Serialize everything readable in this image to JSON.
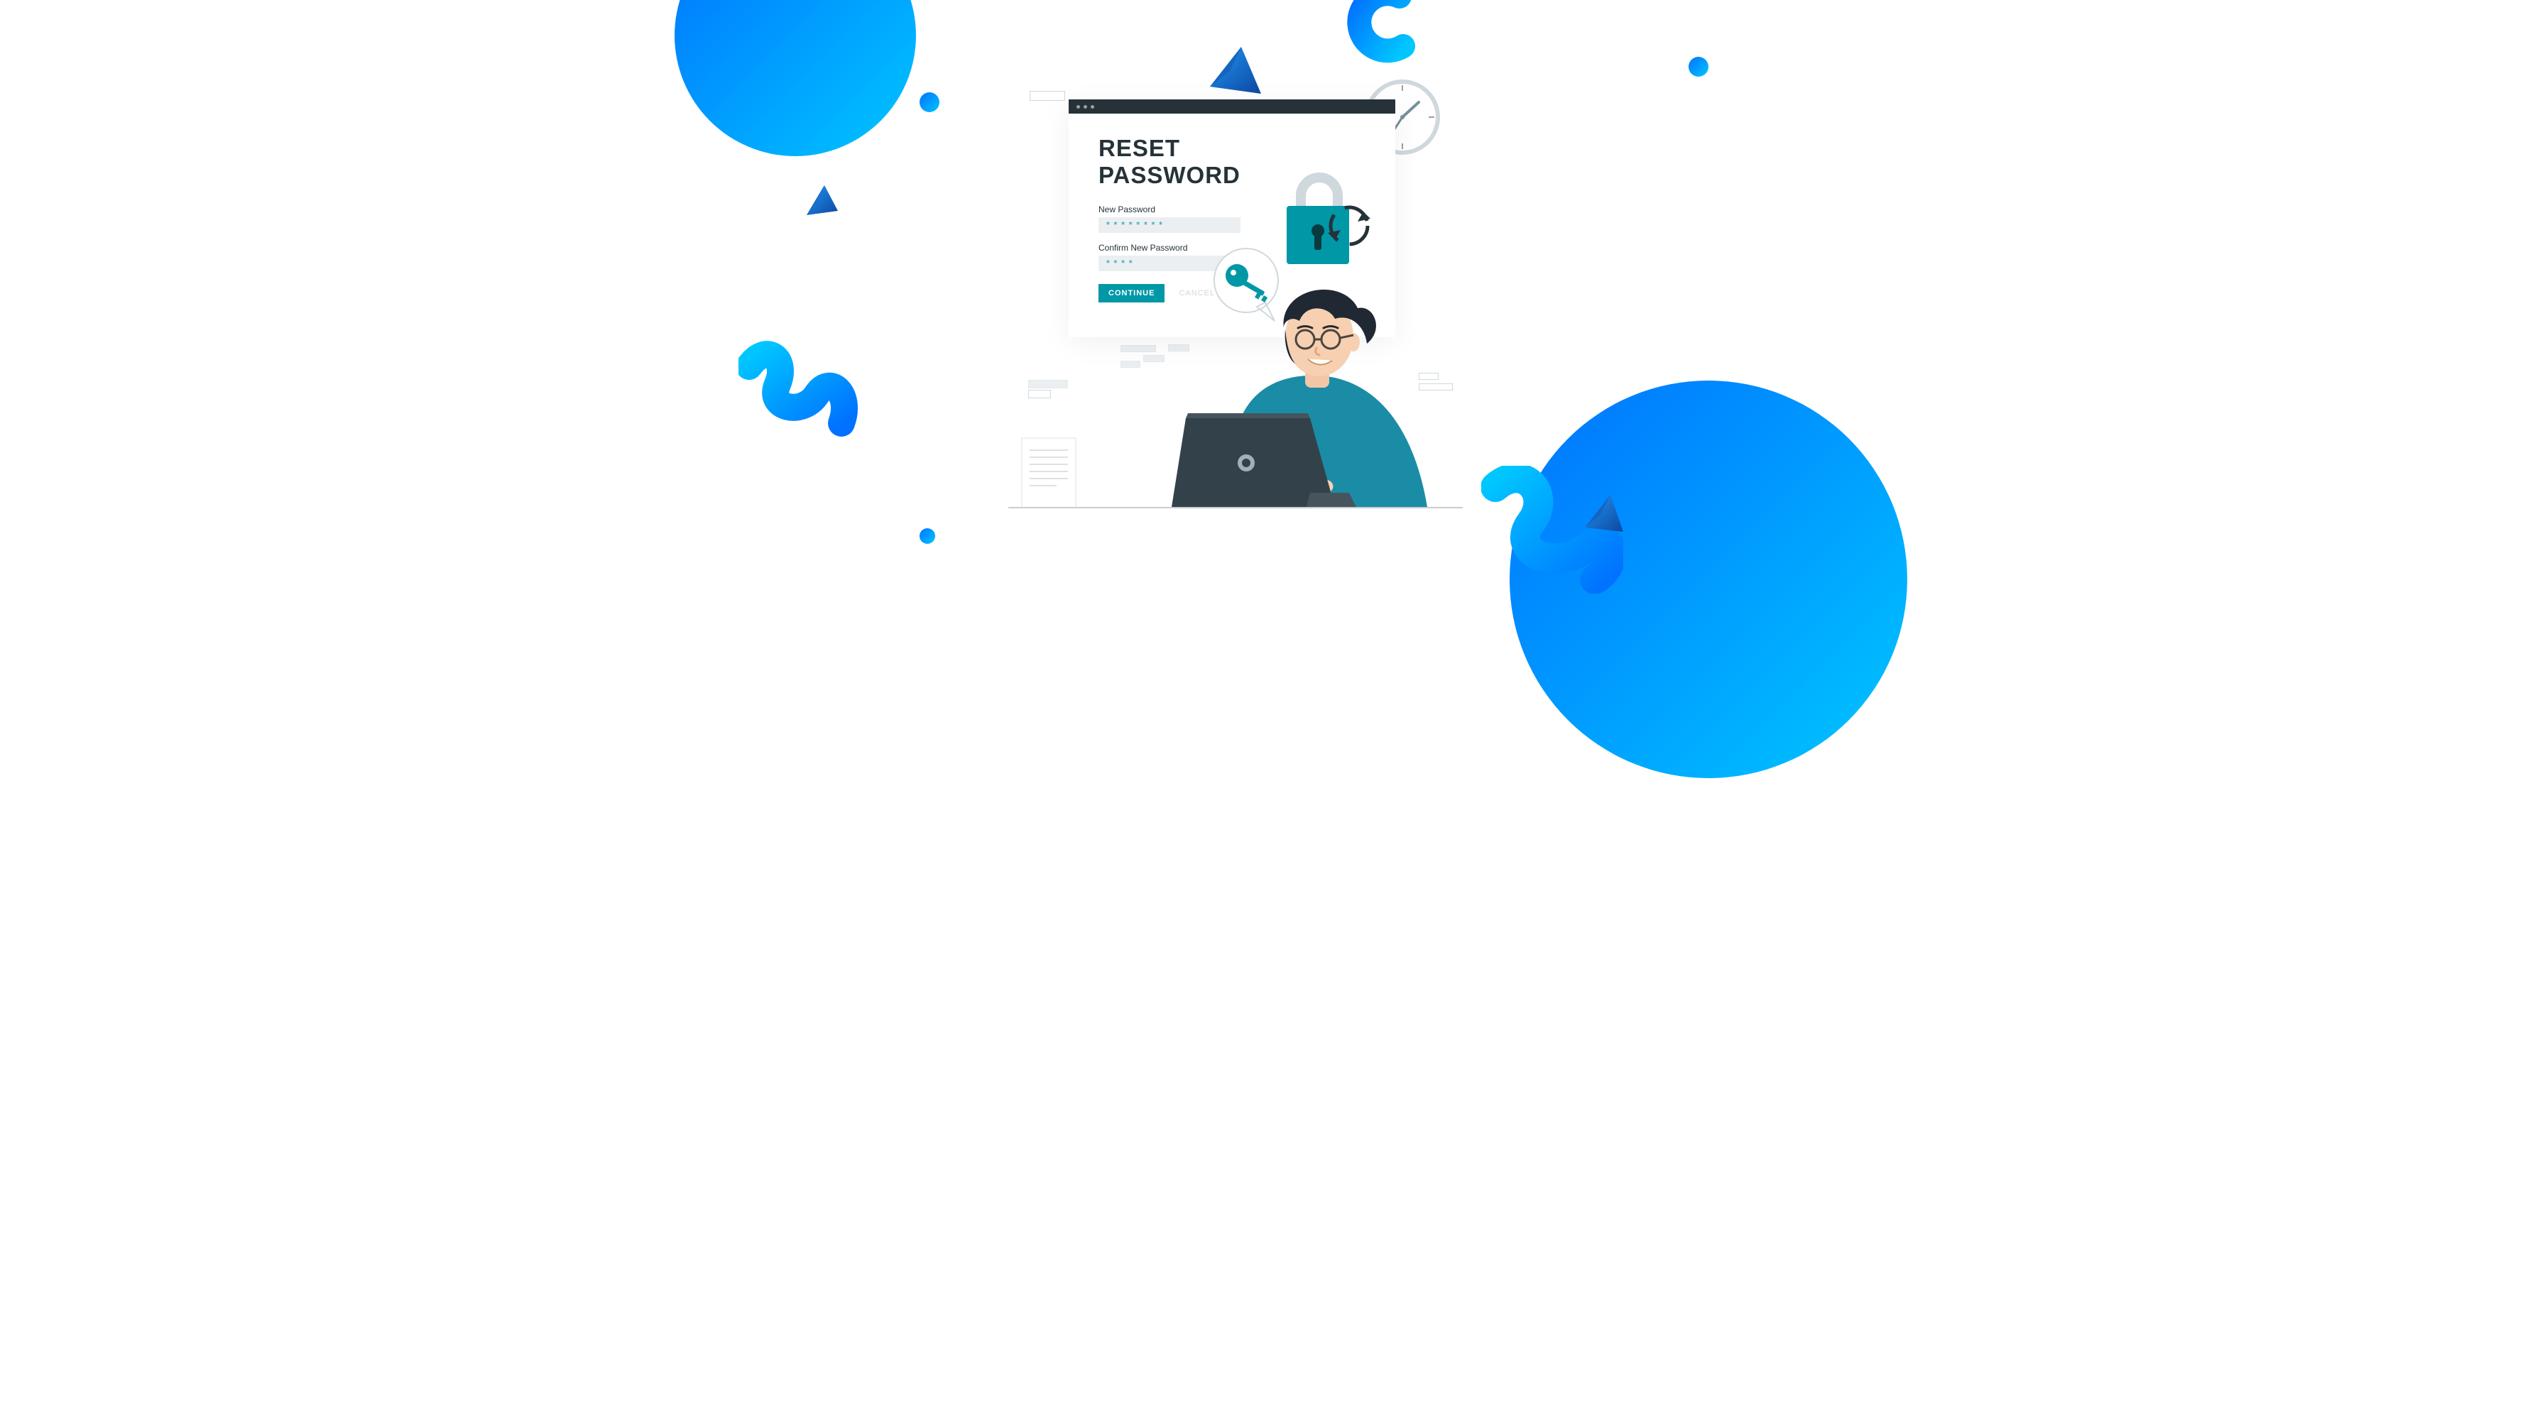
{
  "window": {
    "title": "RESET\nPASSWORD"
  },
  "form": {
    "new_password": {
      "label": "New Password",
      "value": "********"
    },
    "confirm_password": {
      "label": "Confirm New Password",
      "value": "****"
    },
    "continue_label": "CONTINUE",
    "cancel_label": "CANCEL"
  },
  "colors": {
    "accent_gradient_start": "#0072ff",
    "accent_gradient_end": "#00c6ff",
    "teal": "#0097a7",
    "dark": "#263238"
  }
}
